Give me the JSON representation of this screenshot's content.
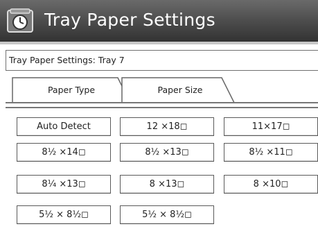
{
  "header": {
    "title": "Tray Paper Settings",
    "icon": "tray-settings-icon"
  },
  "subheader": {
    "text": "Tray Paper Settings: Tray 7"
  },
  "tabs": [
    {
      "label": "Paper Type",
      "selected": false
    },
    {
      "label": "Paper Size",
      "selected": true
    }
  ],
  "sizes": [
    "Auto Detect",
    "12 ×18◻",
    "11×17◻",
    "8½ ×14◻",
    "8½ ×13◻",
    "8½ ×11◻",
    "8¼ ×13◻",
    "8 ×13◻",
    "8 ×10◻",
    "5½ × 8½◻",
    "5½ × 8½◻"
  ],
  "colors": {
    "titlebar": "#4e4e4e",
    "border": "#5a5a5a"
  }
}
